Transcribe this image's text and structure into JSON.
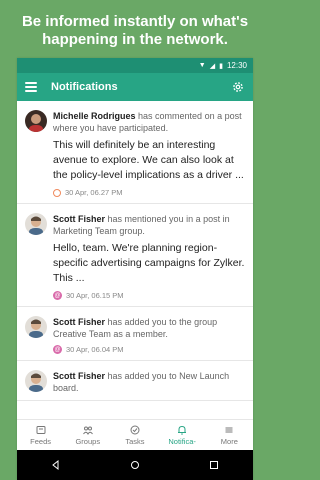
{
  "promo": {
    "line1": "Be informed instantly on what's",
    "line2": "happening in the network."
  },
  "statusbar": {
    "time": "12:30"
  },
  "appbar": {
    "title": "Notifications"
  },
  "notifications": [
    {
      "actor": "Michelle Rodrigues",
      "action": " has commented on a post where you have participated.",
      "content": "This will definitely be an interesting avenue to explore. We can also look at the policy-level implications as a driver ...",
      "time": "30 Apr, 06.27 PM",
      "badge": "comment"
    },
    {
      "actor": "Scott Fisher",
      "action": " has mentioned you in a post in Marketing Team group.",
      "content": "Hello, team. We're planning region-specific advertising campaigns for Zylker. This ...",
      "time": "30 Apr, 06.15 PM",
      "badge": "mention"
    },
    {
      "actor": "Scott Fisher",
      "action": " has added you to the group Creative Team as a member.",
      "content": "",
      "time": "30 Apr, 06.04 PM",
      "badge": "mention"
    },
    {
      "actor": "Scott Fisher",
      "action": " has added you to New Launch board.",
      "content": "",
      "time": "",
      "badge": "mention"
    }
  ],
  "bottomnav": {
    "feeds": "Feeds",
    "groups": "Groups",
    "tasks": "Tasks",
    "notifications": "Notifica-",
    "more": "More"
  },
  "colors": {
    "background": "#6aa866",
    "appbar": "#27a585",
    "statusbar": "#1e8f73",
    "accent": "#27a585"
  }
}
